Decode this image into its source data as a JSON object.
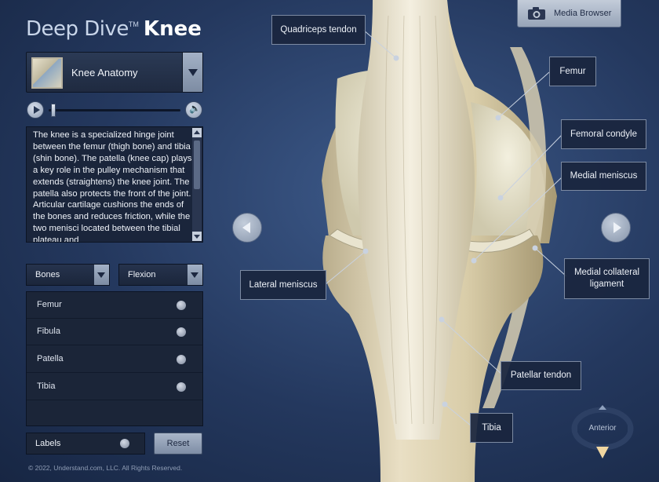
{
  "brand": {
    "prefix": "Deep Dive",
    "trademark": "TM",
    "title": "Knee"
  },
  "module": {
    "label": "Knee Anatomy"
  },
  "description": "The knee is a specialized hinge joint between the femur (thigh bone) and tibia (shin bone). The patella (knee cap) plays a key role in the pulley mechanism that extends (straightens) the knee joint. The patella also protects the front of the joint. Articular cartilage cushions the ends of the bones and reduces friction, while the two menisci located between the tibial plateau and",
  "filters": {
    "category": "Bones",
    "motion": "Flexion"
  },
  "bones": [
    {
      "label": "Femur"
    },
    {
      "label": "Fibula"
    },
    {
      "label": "Patella"
    },
    {
      "label": "Tibia"
    }
  ],
  "labels_toggle": "Labels",
  "reset_label": "Reset",
  "copyright": "© 2022, Understand.com, LLC. All Rights Reserved.",
  "media_browser_label": "Media Browser",
  "compass_label": "Anterior",
  "callouts": {
    "quadriceps_tendon": "Quadriceps tendon",
    "femur": "Femur",
    "femoral_condyle": "Femoral condyle",
    "medial_meniscus": "Medial meniscus",
    "medial_collateral_ligament": "Medial collateral ligament",
    "lateral_meniscus": "Lateral meniscus",
    "patellar_tendon": "Patellar tendon",
    "tibia": "Tibia"
  },
  "icons": [
    "camera-icon",
    "play-icon",
    "volume-icon",
    "chevron-down-icon",
    "arrow-left-icon",
    "arrow-right-icon",
    "compass-icon"
  ],
  "colors": {
    "background": "#24385e",
    "panel": "#1b2538",
    "bone": "#e6dcc0",
    "button": "#97a4b8"
  }
}
